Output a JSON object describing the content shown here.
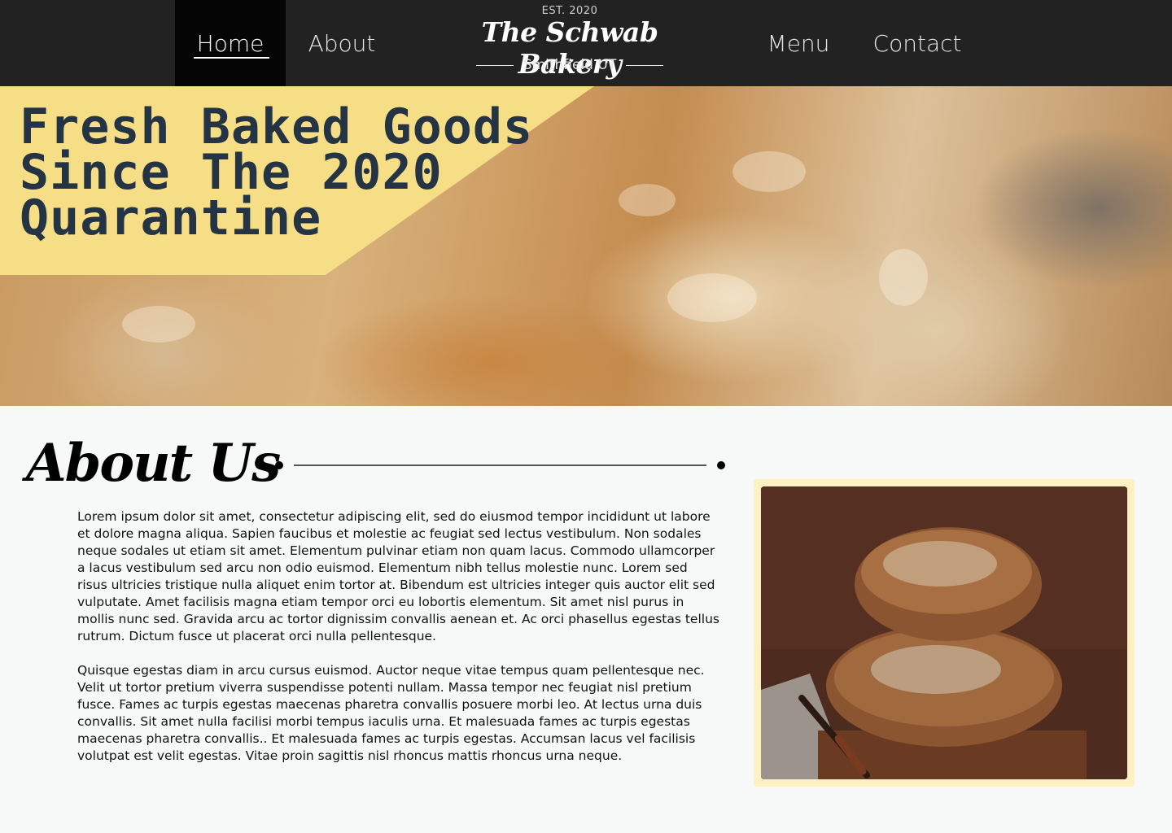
{
  "nav": {
    "items": [
      {
        "id": "home",
        "label": "Home",
        "active": true
      },
      {
        "id": "about",
        "label": "About"
      },
      {
        "id": "menu",
        "label": "Menu"
      },
      {
        "id": "contact",
        "label": "Contact"
      }
    ]
  },
  "brand": {
    "est": "EST. 2020",
    "name": "The Schwab Bakery",
    "location": "Smithfield UT"
  },
  "hero": {
    "title_lines": [
      "Fresh Baked Goods",
      "Since The 2020",
      "Quarantine"
    ],
    "banner_color": "#f6de86",
    "title_color": "#243444"
  },
  "about": {
    "heading": "About Us",
    "paragraphs": [
      "Lorem ipsum dolor sit amet, consectetur adipiscing elit, sed do eiusmod tempor incididunt ut labore et dolore magna aliqua. Sapien faucibus et molestie ac feugiat sed lectus vestibulum. Non sodales neque sodales ut etiam sit amet. Elementum pulvinar etiam non quam lacus. Commodo ullamcorper a lacus vestibulum sed arcu non odio euismod. Elementum nibh tellus molestie nunc. Lorem sed risus ultricies tristique nulla aliquet enim tortor at. Bibendum est ultricies integer quis auctor elit sed vulputate. Amet facilisis magna etiam tempor orci eu lobortis elementum. Sit amet nisl purus in mollis nunc sed. Gravida arcu ac tortor dignissim convallis aenean et. Ac orci phasellus egestas tellus rutrum. Dictum fusce ut placerat orci nulla pellentesque.",
      "Quisque egestas diam in arcu cursus euismod. Auctor neque vitae tempus quam pellentesque nec. Velit ut tortor pretium viverra suspendisse potenti nullam. Massa tempor nec feugiat nisl pretium fusce. Fames ac turpis egestas maecenas pharetra convallis posuere morbi leo. At lectus urna duis convallis. Sit amet nulla facilisi morbi tempus iaculis urna. Et malesuada fames ac turpis egestas maecenas pharetra convallis.. Et malesuada fames ac turpis egestas. Accumsan lacus vel facilisis volutpat est velit egestas. Vitae proin sagittis nisl rhoncus mattis rhoncus urna neque."
    ],
    "photo_frame_color": "#fdf0c2"
  }
}
